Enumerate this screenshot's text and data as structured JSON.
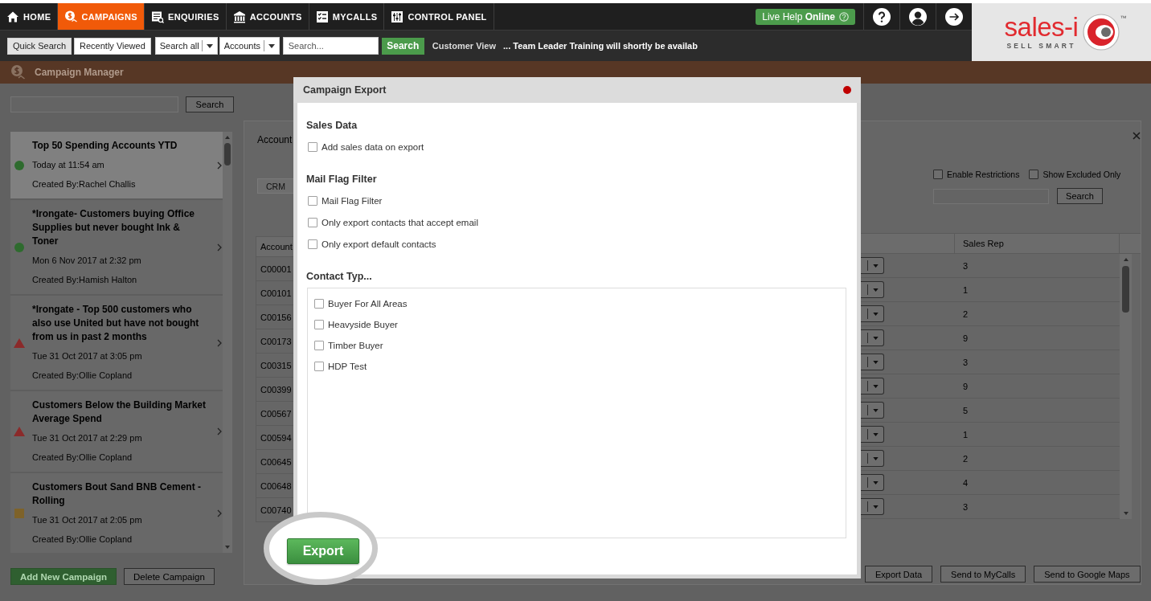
{
  "nav": {
    "items": [
      {
        "label": "HOME",
        "selected": false
      },
      {
        "label": "CAMPAIGNS",
        "selected": true
      },
      {
        "label": "ENQUIRIES",
        "selected": false
      },
      {
        "label": "ACCOUNTS",
        "selected": false
      },
      {
        "label": "MYCALLS",
        "selected": false
      },
      {
        "label": "CONTROL PANEL",
        "selected": false
      }
    ],
    "live_help": "Live Help **Online**"
  },
  "logo": {
    "wordmark": "sales-i",
    "tagline": "SELL SMART",
    "trademark": "™"
  },
  "search_bar": {
    "tabs": [
      {
        "label": "Quick Search",
        "selected": true
      },
      {
        "label": "Recently Viewed",
        "selected": false
      }
    ],
    "dropdowns": [
      "Search all",
      "Accounts"
    ],
    "search": {
      "placeholder": "Search..."
    },
    "search_button": "Search",
    "link": "Customer View",
    "ticker": "... Team Leader Training will shortly be availab"
  },
  "page_header": {
    "title": "Campaign Manager"
  },
  "sidebar": {
    "search_button": "Search",
    "campaigns": [
      {
        "title": "Top 50 Spending Accounts YTD",
        "date": "Today at 11:54 am",
        "created_by": "Created By:Rachel Challis",
        "kind": "circle",
        "color": "#2e6b2e",
        "selected": true
      },
      {
        "title": "*Irongate- Customers buying Office Supplies but never bought Ink & Toner",
        "date": "Mon 6 Nov 2017 at 2:32 pm",
        "created_by": "Created By:Hamish Halton",
        "kind": "circle",
        "color": "#2e6b2e",
        "selected": false
      },
      {
        "title": "*Irongate - Top 500 customers who also use United but have not bought from us in past 2 months",
        "date": "Tue 31 Oct 2017 at 3:05 pm",
        "created_by": "Created By:Ollie Copland",
        "kind": "triangle",
        "color": "#8b2a2a",
        "selected": false
      },
      {
        "title": "Customers Below the Building Market Average Spend",
        "date": "Tue 31 Oct 2017 at 2:29 pm",
        "created_by": "Created By:Ollie Copland",
        "kind": "triangle",
        "color": "#8b2a2a",
        "selected": false
      },
      {
        "title": "Customers Bout Sand BNB Cement - Rolling",
        "date": "Tue 31 Oct 2017 at 2:05 pm",
        "created_by": "Created By:Ollie Copland",
        "kind": "square",
        "color": "#7e6229",
        "selected": false
      }
    ],
    "buttons": [
      {
        "label": "Add New Campaign",
        "kind": "primary"
      },
      {
        "label": "Delete Campaign",
        "kind": "secondary"
      }
    ]
  },
  "account_panel": {
    "title": "Account",
    "crm_button": "CRM",
    "filters": [
      {
        "label": "Enable Restrictions",
        "checked": false
      },
      {
        "label": "Show Excluded Only",
        "checked": false
      }
    ],
    "search_button": "Search",
    "table": {
      "columns": [
        "Account",
        "Sales Rep"
      ],
      "rows": [
        {
          "account": "C00001",
          "sales_rep": "3"
        },
        {
          "account": "C00101",
          "sales_rep": "1"
        },
        {
          "account": "C00156",
          "sales_rep": "2"
        },
        {
          "account": "C00173",
          "sales_rep": "9"
        },
        {
          "account": "C00315",
          "sales_rep": "3"
        },
        {
          "account": "C00399",
          "sales_rep": "9"
        },
        {
          "account": "C00567",
          "sales_rep": "5"
        },
        {
          "account": "C00594",
          "sales_rep": "1"
        },
        {
          "account": "C00645",
          "sales_rep": "2"
        },
        {
          "account": "C00648",
          "sales_rep": "4"
        },
        {
          "account": "C00740",
          "sales_rep": "3"
        }
      ]
    },
    "buttons": [
      "Export Data",
      "Send to MyCalls",
      "Send to Google Maps"
    ]
  },
  "dialog": {
    "title": "Campaign Export",
    "sections": [
      {
        "heading": "Sales Data",
        "kind": "options",
        "options": [
          {
            "label": "Add sales data on export",
            "checked": false
          }
        ]
      },
      {
        "heading": "Mail Flag Filter",
        "kind": "options",
        "options": [
          {
            "label": "Mail Flag Filter",
            "checked": false
          },
          {
            "label": "Only export contacts that accept email",
            "checked": false
          },
          {
            "label": "Only export default contacts",
            "checked": false
          }
        ]
      },
      {
        "heading": "Contact Typ...",
        "kind": "listbox",
        "options": [
          {
            "label": "Buyer For All Areas",
            "checked": false
          },
          {
            "label": "Heavyside Buyer",
            "checked": false
          },
          {
            "label": "Timber Buyer",
            "checked": false
          },
          {
            "label": "HDP Test",
            "checked": false
          }
        ]
      }
    ],
    "export_button": "Export"
  }
}
